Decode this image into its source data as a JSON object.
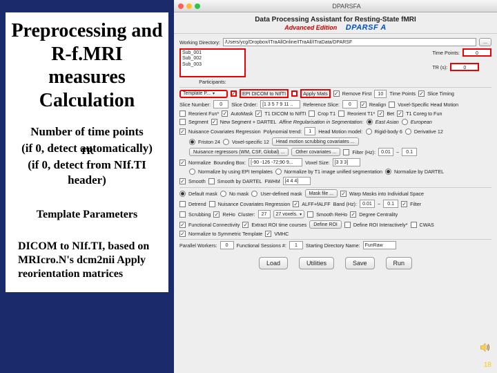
{
  "slide": {
    "title": "Preprocessing and R-f.MRI measures Calculation",
    "tp_label": "Number of time points",
    "tp_sub": "(if 0, detect automatically)",
    "tr_label": "TR",
    "tr_sub": "(if 0, detect from NIf.TI header)",
    "template_label": "Template Parameters",
    "dicom_label": "DICOM to NIf.TI, based on MRIcro.N's dcm2nii Apply reorientation matrices",
    "page_num": "18"
  },
  "app": {
    "window_title": "DPARSFA",
    "header_title": "Data Processing Assistant for Resting-State fMRI",
    "header_edition": "Advanced Edition",
    "header_logo": "DPARSF A",
    "working_dir_label": "Working Directory:",
    "working_dir_value": "/Users/ycg/Dropbox/ITraAllOnline/ITraAll/ITraData/DPARSF",
    "dots_btn": "...",
    "participants_label": "Participants:",
    "subjects": [
      "Sub_001",
      "Sub_002",
      "Sub_003"
    ],
    "time_points_label": "Time Points:",
    "time_points_value": "0",
    "tr_label": "TR (s):",
    "tr_value": "0",
    "template_p": "Template P...",
    "epi_dicom": "EPI DICOM to NIfTI",
    "apply_mats": "Apply Mats",
    "remove_first_label": "Remove First",
    "remove_first_value": "10",
    "time_points2": "Time Points",
    "slice_timing": "Slice Timing",
    "slice_number_label": "Slice Number:",
    "slice_number_value": "0",
    "slice_order_label": "Slice Order:",
    "slice_order_value": "[1 3 5 7 9 11 ..",
    "ref_slice_label": "Reference Slice:",
    "ref_slice_value": "0",
    "realign": "Realign",
    "voxel_hm": "Voxel-Specific Head Motion",
    "reorient_fun": "Reorient Fun*",
    "automask": "AutoMask",
    "t1_dicom": "T1 DICOM to NIfTI",
    "crop_t1": "Crop T1",
    "reorient_t1": "Reorient T1*",
    "bet": "Bet",
    "t1_coreg": "T1 Coreg to Fun",
    "segment": "Segment",
    "new_segment": "New Segment + DARTEL",
    "affine_reg": "Affine Regularisation in Segmentation:",
    "east_asian": "East Asian",
    "european": "European",
    "nuisance_cov": "Nuisance Covariates Regression",
    "poly_trend": "Polynomial trend:",
    "poly_trend_value": "1",
    "head_motion_model": "Head Motion model:",
    "hm_sel": "Rigid-body 6",
    "deriv12": "Derivative 12",
    "friston": "Friston 24",
    "voxel_spec12": "Voxel-specific 12",
    "hm_covariates": "Head motion scrubbing covariates ...",
    "nuisance_wm": "Nuisance regressors (WM, CSF, Global) ...",
    "other_cov": "Other covariates ...",
    "filter": "Filter (Hz):",
    "filter_lo": "0.01",
    "filter_hi": "0.1",
    "normalize": "Normalize",
    "bb_label": "Bounding Box:",
    "bb_value": "[-90 -126 -72;90 9...",
    "voxel_label": "Voxel Size:",
    "voxel_value": "[3 3 3]",
    "norm_epi": "Normalize by using EPI templates",
    "norm_t1": "Normalize by T1 image unified segmentation",
    "norm_dartel": "Normalize by DARTEL",
    "smooth": "Smooth",
    "smooth_dartel": "Smooth by DARTEL",
    "fwhm_label": "FWHM",
    "fwhm_value": "[4 4 4]",
    "default_mask": "Default mask",
    "no_mask": "No mask",
    "user_mask": "User-defined mask",
    "mask_file": "Mask file ...",
    "warp_masks": "Warp Masks into Individual Space",
    "detrend": "Detrend",
    "nuisance_cov2": "Nuisance Covariates Regression",
    "alff": "ALFF+fALFF",
    "band_label": "Band (Hz):",
    "band_lo": "0.01",
    "band_hi": "0.1",
    "filter_cb": "Filter",
    "scrubbing": "Scrubbing",
    "reho": "ReHo",
    "cluster_label": "Cluster:",
    "cluster_value": "27",
    "voxels": "27 voxels.",
    "smooth_reho": "Smooth ReHo",
    "degree_cent": "Degree Centrality",
    "fc": "Functional Connectivity",
    "extract_roi": "Extract ROI time courses",
    "define_roi": "Define ROI",
    "define_roi_int": "Define ROI Interactively*",
    "cwas": "CWAS",
    "norm_symm": "Normalize to Symmetric Template",
    "vmhc": "VMHC",
    "parallel_label": "Parallel Workers:",
    "parallel_value": "0",
    "func_sess_label": "Functional Sessions #:",
    "func_sess_value": "1",
    "start_dir_label": "Starting Directory Name:",
    "start_dir_value": "FunRaw",
    "btn_load": "Load",
    "btn_utilities": "Utilities",
    "btn_save": "Save",
    "btn_run": "Run"
  }
}
